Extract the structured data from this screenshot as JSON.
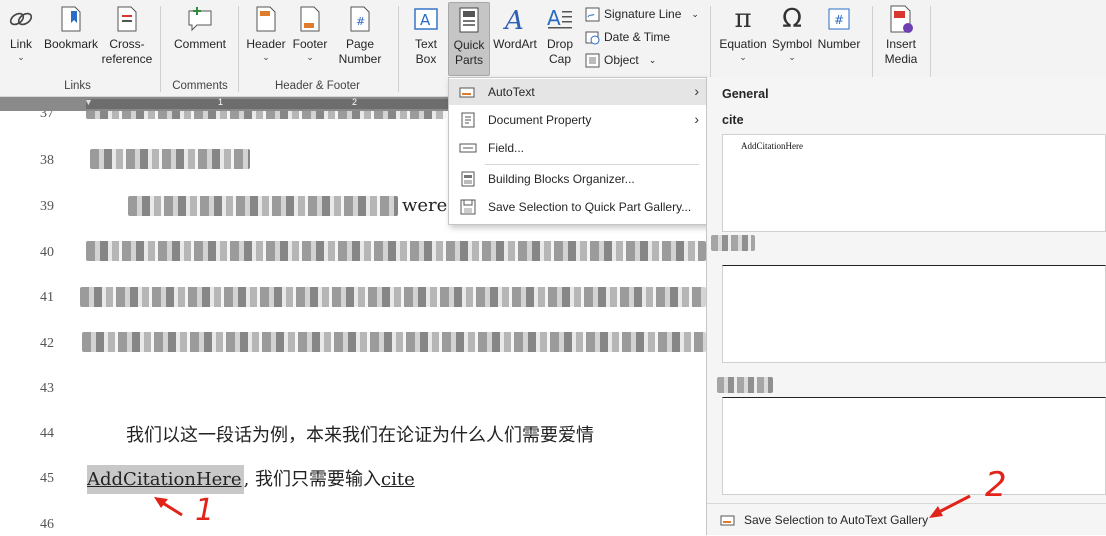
{
  "ribbon": {
    "groups": {
      "links": {
        "label": "Links",
        "buttons": {
          "link": "Link",
          "bookmark": "Bookmark",
          "cross_reference": "Cross-\nreference"
        }
      },
      "comments": {
        "label": "Comments",
        "buttons": {
          "comment": "Comment"
        }
      },
      "header_footer": {
        "label": "Header & Footer",
        "buttons": {
          "header": "Header",
          "footer": "Footer",
          "page_number": "Page\nNumber"
        }
      },
      "text": {
        "buttons": {
          "text_box": "Text\nBox",
          "quick_parts": "Quick\nParts",
          "wordart": "WordArt",
          "drop_cap": "Drop\nCap",
          "signature_line": "Signature Line",
          "date_time": "Date & Time",
          "object": "Object"
        }
      },
      "symbols": {
        "buttons": {
          "equation": "Equation",
          "symbol": "Symbol",
          "number": "Number"
        }
      },
      "media": {
        "buttons": {
          "insert_media": "Insert\nMedia"
        }
      }
    }
  },
  "ruler": {
    "ticks": [
      "1",
      "2"
    ]
  },
  "document": {
    "line_numbers": [
      "37",
      "38",
      "39",
      "40",
      "41",
      "42",
      "43",
      "44",
      "45",
      "46"
    ],
    "line39_visible": "were",
    "line44_text": "我们以这一段话为例，本来我们在论证为什么人们需要爱情",
    "line45_highlight": "AddCitationHere",
    "line45_middle": ", 我们只需要输入",
    "line45_keyword": "cite"
  },
  "quick_parts_menu": {
    "items": [
      {
        "label": "AutoText",
        "icon": "autotext-icon"
      },
      {
        "label": "Document Property",
        "icon": "document-property-icon"
      },
      {
        "label": "Field...",
        "icon": "field-icon"
      },
      {
        "label": "Building Blocks Organizer...",
        "icon": "building-blocks-icon"
      },
      {
        "label": "Save Selection to Quick Part Gallery...",
        "icon": "save-selection-icon"
      }
    ]
  },
  "autotext_gallery": {
    "section": "General",
    "entry_name": "cite",
    "entry_preview": "AddCitationHere",
    "footer": "Save Selection to AutoText Gallery"
  },
  "annotations": {
    "arrow1_label": "1",
    "arrow2_label": "2"
  },
  "colors": {
    "annotation": "#e2231a",
    "ribbon_bg": "#f3f3f3",
    "selected_item": "#e5e5e5",
    "highlight": "#c8c8c8",
    "wordart_blue": "#2b5fb4"
  }
}
